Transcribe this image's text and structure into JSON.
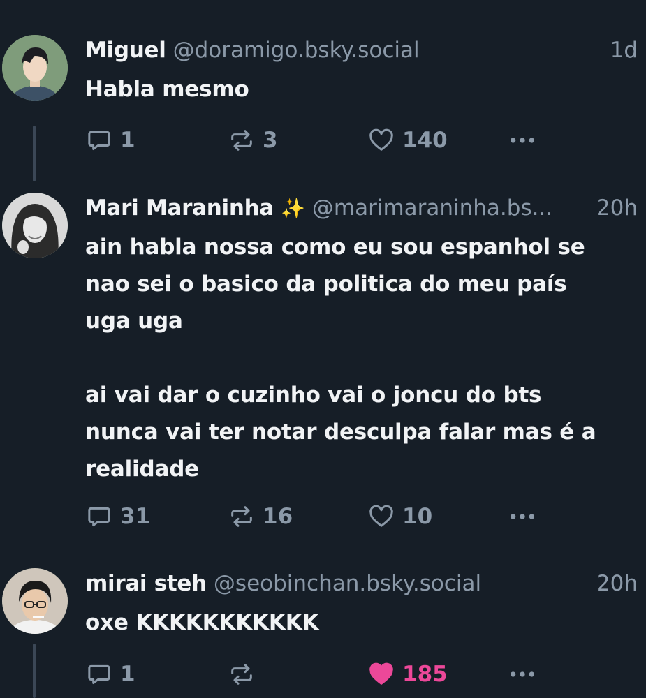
{
  "posts": [
    {
      "display_name": "Miguel",
      "handle": "@doramigo.bsky.social",
      "time": "1d",
      "text": [
        "Habla mesmo"
      ],
      "counts": {
        "replies": "1",
        "reposts": "3",
        "likes": "140"
      },
      "liked": false,
      "avatar_icon": "avatar-photo-young-man"
    },
    {
      "display_name": "Mari Maraninha",
      "emoji": "✨",
      "handle": "@marimaraninha.bs...",
      "time": "20h",
      "text": [
        "ain habla nossa como eu sou espanhol se nao sei o basico da politica do meu país uga uga",
        "ai vai dar o cuzinho vai o joncu do bts nunca vai ter notar desculpa falar mas é a realidade"
      ],
      "counts": {
        "replies": "31",
        "reposts": "16",
        "likes": "10"
      },
      "liked": false,
      "avatar_icon": "avatar-photo-woman-grayscale"
    },
    {
      "display_name": "mirai steh",
      "handle": "@seobinchan.bsky.social",
      "time": "20h",
      "text": [
        "oxe KKKKKKKKKKK"
      ],
      "counts": {
        "replies": "1",
        "reposts": "",
        "likes": "185"
      },
      "liked": true,
      "avatar_icon": "avatar-photo-man-glasses"
    }
  ],
  "colors": {
    "background": "#161e27",
    "muted": "#8b99a8",
    "text": "#f1f3f5",
    "like_active": "#ec4899",
    "thread_line": "#3b4756"
  }
}
